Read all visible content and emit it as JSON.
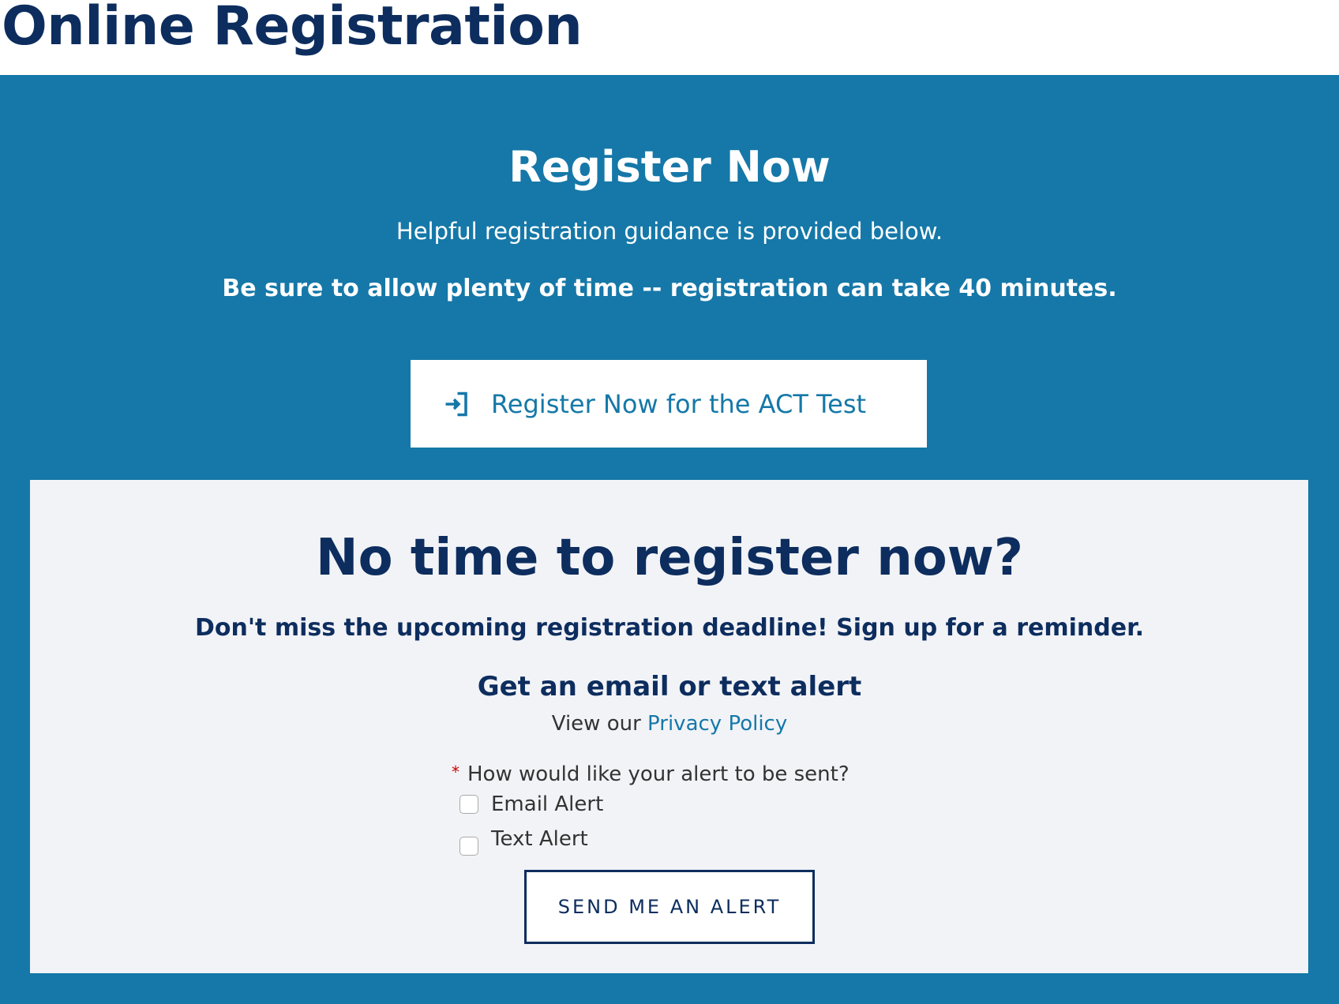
{
  "page_title": "Online Registration",
  "register": {
    "heading": "Register Now",
    "subtitle": "Helpful registration guidance is provided below.",
    "warning": "Be sure to allow plenty of time -- registration can take 40 minutes.",
    "button_label": "Register Now for the ACT Test",
    "button_icon": "sign-in-icon"
  },
  "reminder": {
    "heading": "No time to register now?",
    "subheading": "Don't miss the upcoming registration deadline! Sign up for a reminder.",
    "alert_heading": "Get an email or text alert",
    "privacy_prefix": "View our",
    "privacy_link": "Privacy Policy",
    "question_required": "*",
    "question": "How would like your alert to be sent?",
    "options": [
      {
        "label": "Email Alert",
        "checked": false
      },
      {
        "label": "Text Alert",
        "checked": false
      }
    ],
    "submit_label": "SEND ME AN ALERT"
  },
  "colors": {
    "primary_blue": "#1578a8",
    "navy": "#0d2d5e",
    "panel": "#f2f3f7",
    "required": "#cc0000"
  }
}
